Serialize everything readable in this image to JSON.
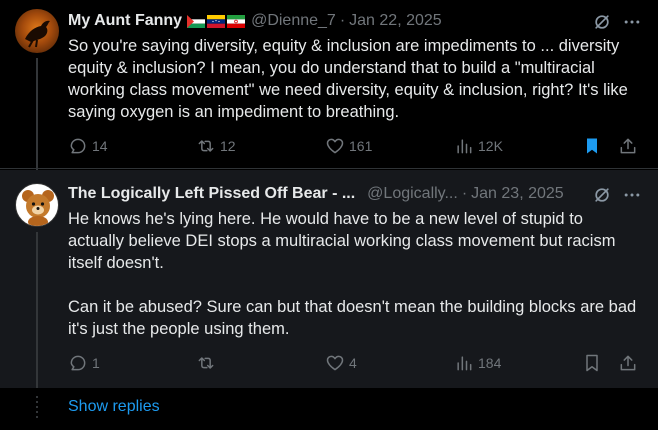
{
  "posts": [
    {
      "author": "My Aunt Fanny",
      "flags": [
        "flag-palestine-icon",
        "flag-venezuela-icon",
        "flag-iran-icon"
      ],
      "handle": "@Dienne_7",
      "date": "Jan 22, 2025",
      "text": "So you're saying diversity, equity & inclusion are impediments to ... diversity equity & inclusion? I mean, you do understand that to build a \"multiracial working class movement\" we need diversity, equity & inclusion, right? It's like saying oxygen is an impediment to breathing.",
      "replies": "14",
      "reposts": "12",
      "likes": "161",
      "views": "12K",
      "bookmarked": true
    },
    {
      "author": "The Logically Left Pissed Off Bear - ...",
      "handle": "@Logically...",
      "date": "Jan 23, 2025",
      "text": "He knows he's lying here. He would have to be a new level of stupid to actually believe DEI stops a multiracial working class movement but racism itself doesn't.\n\nCan it be abused? Sure can but that doesn't mean the building blocks are bad it's just the people using them.",
      "replies": "1",
      "reposts": "",
      "likes": "4",
      "views": "184",
      "bookmarked": false
    }
  ],
  "show_replies_label": "Show replies",
  "colors": {
    "background": "#000000",
    "highlight_background": "#16181c",
    "text": "#e7e9ea",
    "muted": "#71767b",
    "accent": "#1d9bf0"
  }
}
